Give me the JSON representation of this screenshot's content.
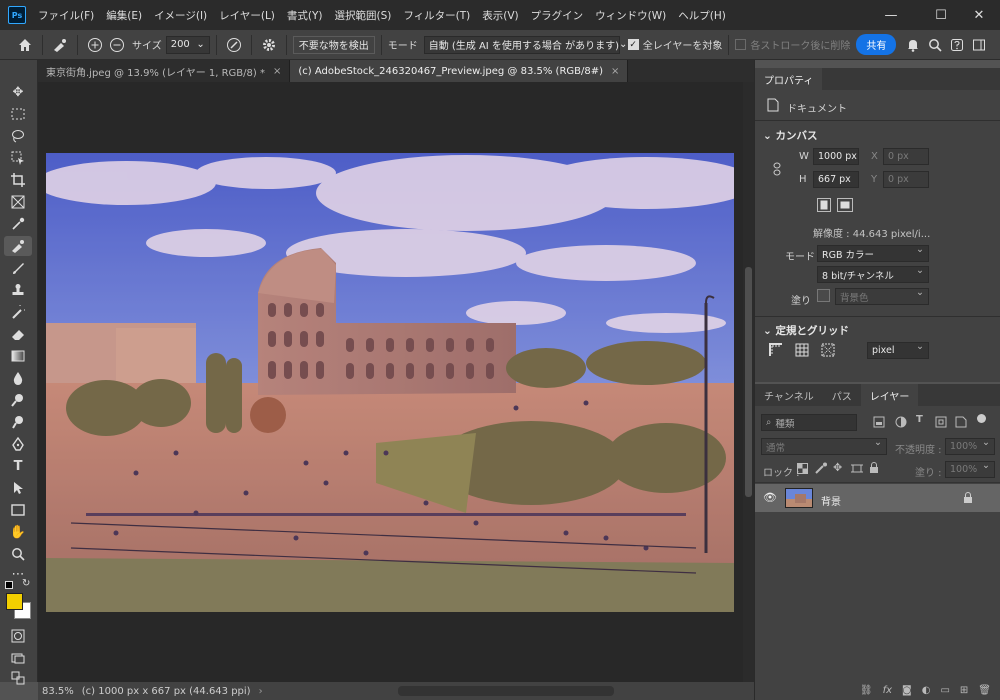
{
  "app": {
    "logo": "Ps"
  },
  "menu": [
    "ファイル(F)",
    "編集(E)",
    "イメージ(I)",
    "レイヤー(L)",
    "書式(Y)",
    "選択範囲(S)",
    "フィルター(T)",
    "表示(V)",
    "プラグイン",
    "ウィンドウ(W)",
    "ヘルプ(H)"
  ],
  "window_controls": {
    "minimize": "—",
    "maximize": "☐",
    "close": "✕"
  },
  "options": {
    "size_label": "サイズ",
    "size_value": "200",
    "detect_button": "不要な物を検出",
    "mode_label": "モード",
    "mode_value": "自動 (生成 AI を使用する場合 があります)",
    "all_layers_label": "全レイヤーを対象",
    "after_stroke_label": "各ストローク後に削除",
    "share_label": "共有"
  },
  "doc_tabs": [
    {
      "label": "東京街角.jpeg @ 13.9% (レイヤー 1, RGB/8) *",
      "close": "×"
    },
    {
      "label": "(c) AdobeStock_246320467_Preview.jpeg @ 83.5% (RGB/8#)",
      "close": "×"
    }
  ],
  "status": {
    "zoom": "83.5%",
    "info": "(c) 1000 px x 667 px (44.643 ppi)",
    "arrow": "›"
  },
  "properties": {
    "tab": "プロパティ",
    "doc_label": "ドキュメント",
    "canvas_header": "カンバス",
    "w_label": "W",
    "w_value": "1000 px",
    "h_label": "H",
    "h_value": "667 px",
    "x_label": "X",
    "x_value": "0 px",
    "y_label": "Y",
    "y_value": "0 px",
    "resolution": "解像度 : 44.643 pixel/i...",
    "mode_label": "モード",
    "mode_value": "RGB カラー",
    "bit_value": "8 bit/チャンネル",
    "fill_label": "塗り",
    "fill_value": "背景色",
    "rulers_header": "定規とグリッド",
    "unit_value": "pixel"
  },
  "layers_panel": {
    "tabs": [
      "チャンネル",
      "パス",
      "レイヤー"
    ],
    "kind_filter": "種類",
    "blend_mode": "通常",
    "opacity_label": "不透明度 :",
    "opacity_value": "100%",
    "lock_label": "ロック :",
    "fill_label": "塗り :",
    "fill_value": "100%",
    "layer_name": "背景"
  },
  "colors": {
    "foreground": "#f2cf00",
    "background": "#ffffff",
    "accent": "#1473e6"
  }
}
